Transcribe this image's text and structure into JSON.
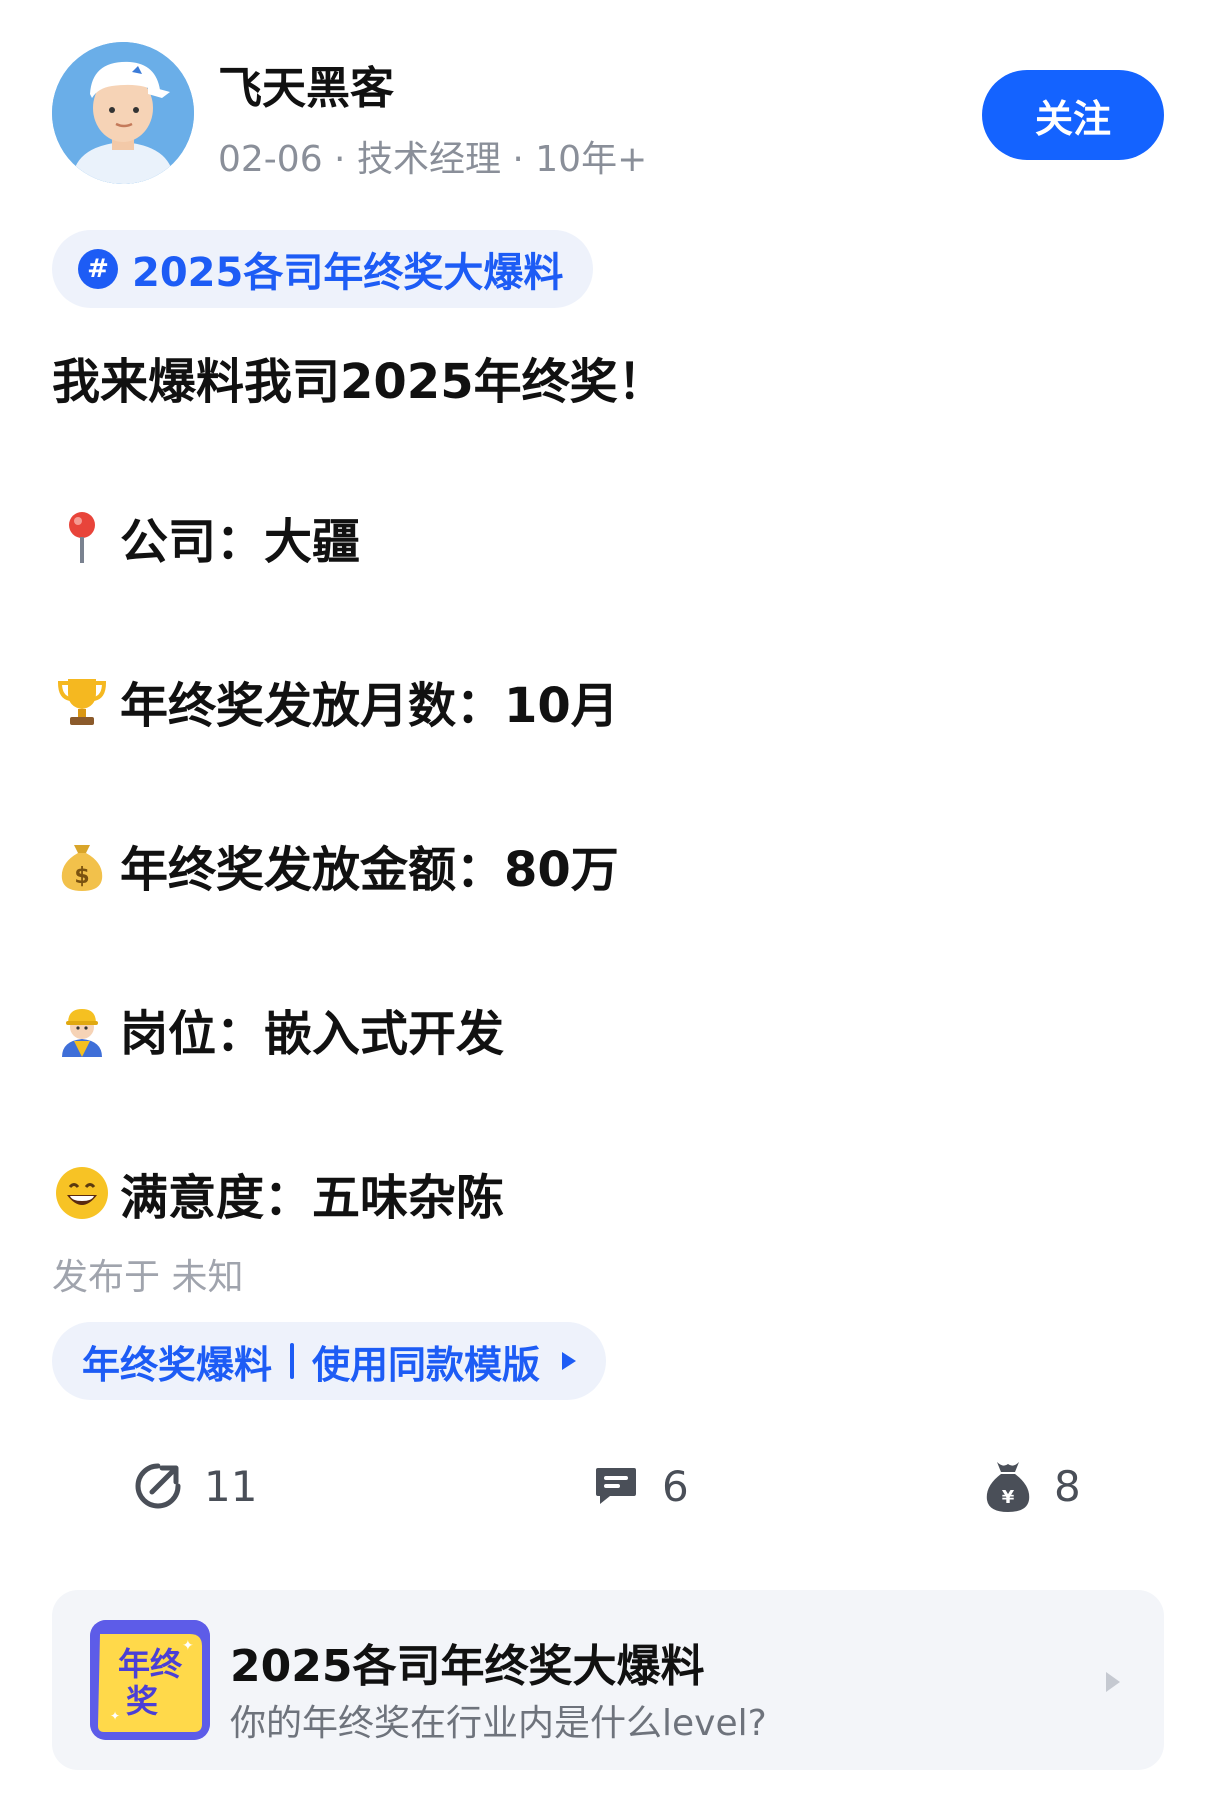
{
  "header": {
    "username": "飞天黑客",
    "meta": "02-06 · 技术经理 · 10年+",
    "follow_label": "关注"
  },
  "topic": {
    "label": "2025各司年终奖大爆料"
  },
  "post": {
    "headline": "我来爆料我司2025年终奖！",
    "fields": [
      {
        "icon": "pin-icon",
        "text": "公司：大疆"
      },
      {
        "icon": "trophy-icon",
        "text": "年终奖发放月数：10月"
      },
      {
        "icon": "money-bag-icon",
        "text": "年终奖发放金额：80万"
      },
      {
        "icon": "construction-worker-icon",
        "text": "岗位：嵌入式开发"
      },
      {
        "icon": "grinning-face-icon",
        "text": "满意度：五味杂陈"
      }
    ],
    "published": "发布于 未知"
  },
  "template": {
    "left": "年终奖爆料",
    "right": "使用同款模版"
  },
  "actions": {
    "share_count": "11",
    "comment_count": "6",
    "reward_count": "8"
  },
  "card": {
    "logo_text": "年终奖",
    "title": "2025各司年终奖大爆料",
    "subtitle": "你的年终奖在行业内是什么level?"
  },
  "colors": {
    "accent": "#1463ff",
    "topic_blue": "#1d5cf5",
    "pill_bg": "#eef2fb",
    "muted": "#8a8f99"
  }
}
